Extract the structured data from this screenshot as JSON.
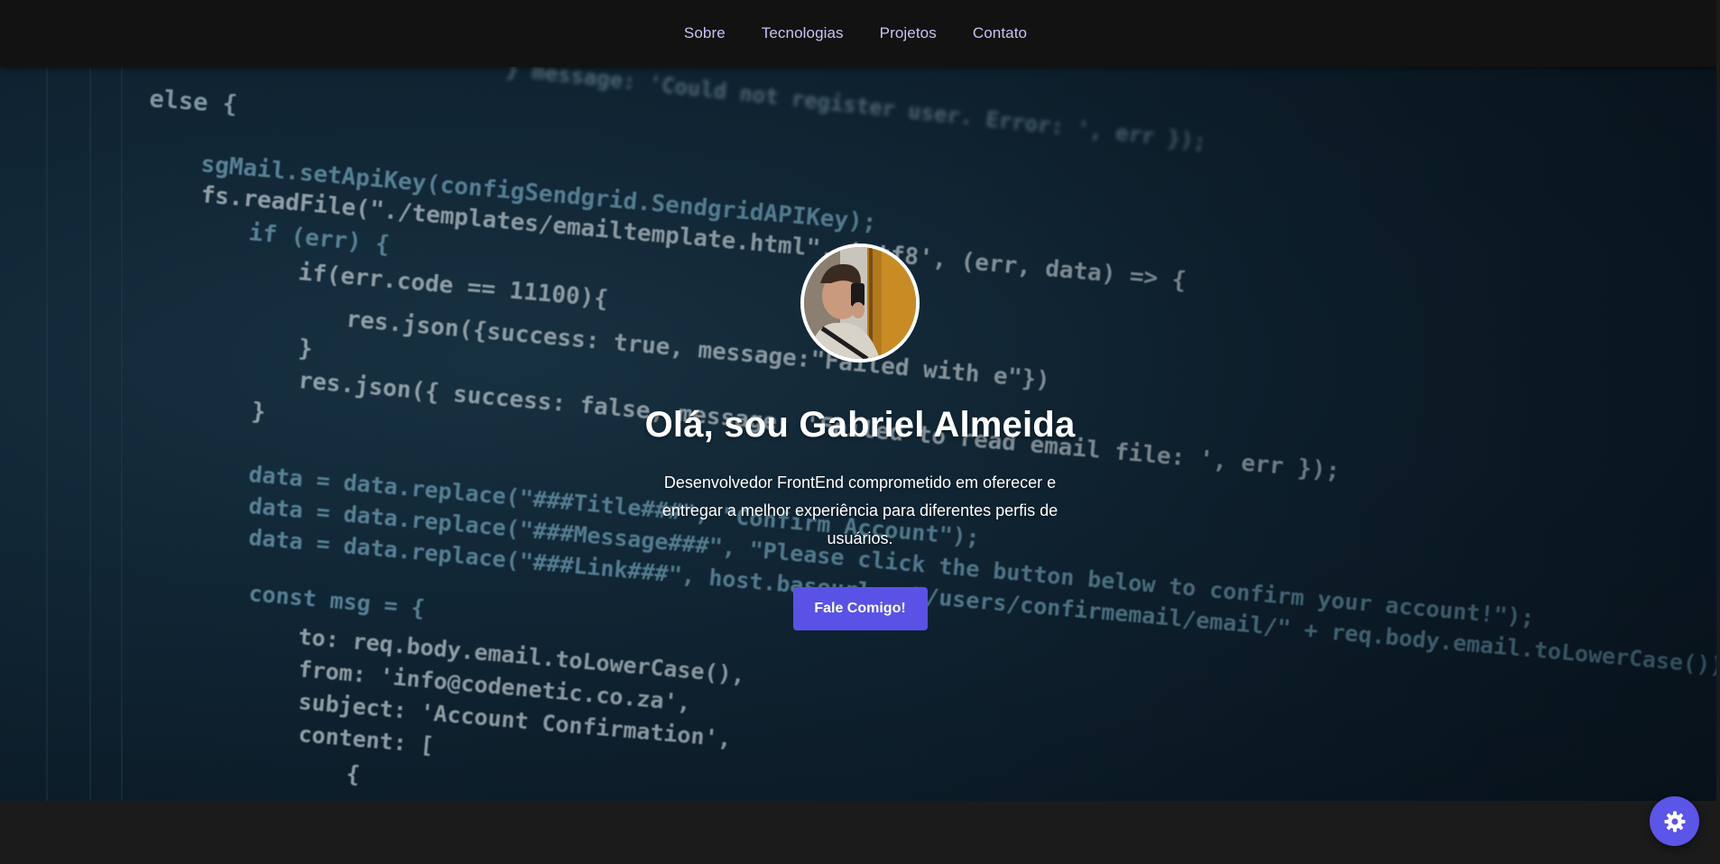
{
  "nav": {
    "items": [
      {
        "label": "Sobre"
      },
      {
        "label": "Tecnologias"
      },
      {
        "label": "Projetos"
      },
      {
        "label": "Contato"
      }
    ]
  },
  "hero": {
    "title": "Olá, sou Gabriel Almeida",
    "subtitle": "Desenvolvedor FrontEnd comprometido em oferecer e entregar a melhor experiência para diferentes perfis de usuários.",
    "cta_label": "Fale Comigo!"
  },
  "background_code": [
    "} message: 'Could not register user. Error: ', err });",
    "else {",
    "sgMail.setApiKey(configSendgrid.SendgridAPIKey);",
    "fs.readFile(\"./templates/emailtemplate.html\", 'utf8', (err, data) => {",
    "if (err) {",
    "if(err.code == 11100){",
    "res.json({success: true, message:\"Failed with e\"})",
    "}",
    "res.json({ success: false, message: 'Failed to read email file: ', err });",
    "}",
    "data = data.replace(\"###Title###\", \"Confirm Account\");",
    "data = data.replace(\"###Message###\", \"Please click the button below to confirm your account!\");",
    "data = data.replace(\"###Link###\", host.baseurl + \"/users/confirmemail/email/\" + req.body.email.toLowerCase());",
    "const msg = {",
    "to: req.body.email.toLowerCase(),",
    "from: 'info@codenetic.co.za',",
    "subject: 'Account Confirmation',",
    "content: [",
    "{"
  ],
  "colors": {
    "accent": "#5a52e6",
    "nav_link": "#c7c3f4",
    "nav_bg": "#121212",
    "page_bg": "#1b1b1b"
  },
  "icons": {
    "theme_toggle": "gear-icon"
  }
}
